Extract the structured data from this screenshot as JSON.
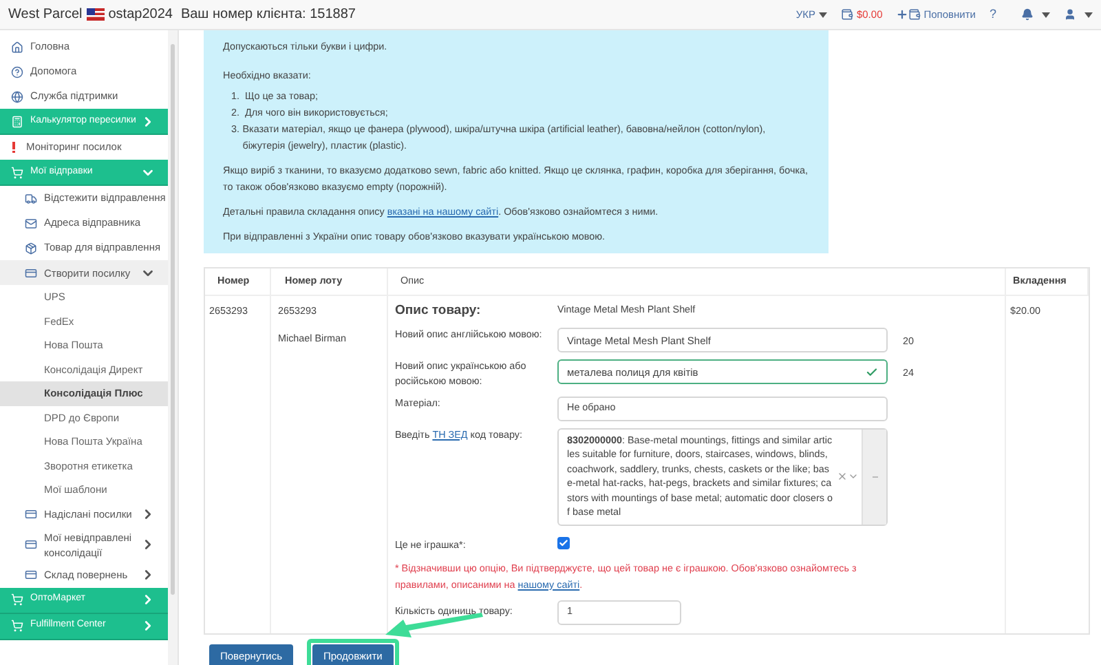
{
  "header": {
    "brand": "West Parcel",
    "username": "ostap2024",
    "client_number": "Ваш номер клієнта: 151887",
    "language": "УКР",
    "balance": "$0.00",
    "top_up": "Поповнити",
    "help": "?"
  },
  "sidebar": {
    "items": [
      {
        "label": "Головна",
        "kind": "link"
      },
      {
        "label": "Допомога",
        "kind": "link"
      },
      {
        "label": "Служба підтримки",
        "kind": "link"
      },
      {
        "label": "Калькулятор пересилки",
        "kind": "section",
        "expanded": false
      },
      {
        "label": "Моніторинг посилок",
        "kind": "alert"
      },
      {
        "label": "Мої відправки",
        "kind": "section",
        "expanded": true,
        "children": [
          {
            "label": "Відстежити відправлення",
            "kind": "link"
          },
          {
            "label": "Адреса відправника",
            "kind": "link"
          },
          {
            "label": "Товар для відправлення",
            "kind": "link"
          },
          {
            "label": "Створити посилку",
            "kind": "group",
            "expanded": true,
            "children": [
              {
                "label": "UPS",
                "selected": false
              },
              {
                "label": "FedEx",
                "selected": false
              },
              {
                "label": "Нова Пошта",
                "selected": false
              },
              {
                "label": "Консолідація Директ",
                "selected": false
              },
              {
                "label": "Консолідація Плюс",
                "selected": true
              },
              {
                "label": "DPD до Європи",
                "selected": false
              },
              {
                "label": "Нова Пошта Україна",
                "selected": false
              },
              {
                "label": "Зворотня етикетка",
                "selected": false
              },
              {
                "label": "Мої шаблони",
                "selected": false
              }
            ]
          },
          {
            "label": "Надіслані посилки",
            "kind": "group",
            "expanded": false
          },
          {
            "label": "Мої невідправлені консолідації",
            "kind": "group",
            "expanded": false
          },
          {
            "label": "Склад повернень",
            "kind": "group",
            "expanded": false
          }
        ]
      },
      {
        "label": "ОптоМаркет",
        "kind": "section",
        "expanded": false
      },
      {
        "label": "Fulfillment Center",
        "kind": "section",
        "expanded": false
      }
    ]
  },
  "info": {
    "lines": [
      "Допускаються тільки букви і цифри.",
      "Необхідно вказати:"
    ],
    "list": [
      {
        "number": "1.",
        "text": "Що це за товар;"
      },
      {
        "number": "2.",
        "text": "Для чого він використовується;"
      },
      {
        "number": "3.",
        "text": "Вказати матеріал, якщо це фанера (plywood), шкіра/штучна шкіра (artificial leather), бавовна/нейлон (cotton/nylon), біжутерія (jewelry), пластик (plastic)."
      }
    ],
    "fabric_note": "Якщо виріб з тканини, то вказуємо додатково sewn, fabric або knitted. Якщо це склянка, графин, коробка для зберігання, бочка, то також обов'язково вказуємо empty (порожній).",
    "rules": {
      "before": "Детальні правила складання опису ",
      "link": "вказані на нашому сайті",
      "after": ". Обов'язково ознайомтеся з ними."
    },
    "ukraine_note": "При відправленні з України опис товару обов'язково вказувати українською мовою."
  },
  "table": {
    "columns": [
      "Номер",
      "Номер лоту",
      "Опис",
      "Вкладення"
    ],
    "row": {
      "number": "2653293",
      "lot": "2653293",
      "recipient": "Michael Birman",
      "declared_value": "$20.00",
      "description": {
        "heading": "Опис товару:",
        "original": "Vintage Metal Mesh Plant Shelf",
        "english": {
          "label": "Новий опис англійською мовою:",
          "value": "Vintage Metal Mesh Plant Shelf",
          "count": "20",
          "valid": false
        },
        "ukrainian": {
          "label": "Новий опис українською або російською мовою:",
          "value": "металева полиця для квітів",
          "count": "24",
          "valid": true
        },
        "material": {
          "label": "Матеріал:",
          "value": "Не обрано"
        },
        "hs_code": {
          "before": "Введіть ",
          "link": "ТН ЗЕД",
          "after": " код товару:",
          "value": "**8302000000**: Base-metal mountings, fittings and similar articles suitable for furniture, doors, staircases, windows, blinds, coachwork, saddlery, trunks, chests, caskets or the like; base-metal hat-racks, hat-pegs, brackets and similar fixtures; castors with mountings of base metal; automatic door closers of base metal"
        },
        "not_toy": {
          "label": "Це не іграшка*:",
          "checked": true
        },
        "warning": {
          "text": "* Відзначивши цю опцію, Ви підтверджуєте, що цей товар не є іграшкою. Обов'язково ознайомтесь з правилами, описаними на ",
          "link": "нашому сайті",
          "after": "."
        },
        "quantity": {
          "label": "Кількість одиниць товару:",
          "value": "1"
        }
      }
    }
  },
  "buttons": [
    {
      "label": "Повернутись",
      "highlighted": false
    },
    {
      "label": "Продовжити",
      "highlighted": true
    }
  ]
}
